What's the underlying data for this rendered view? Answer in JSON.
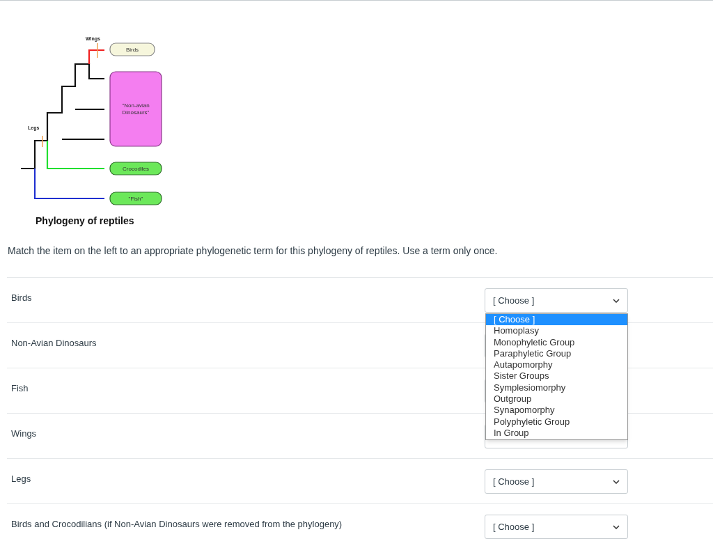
{
  "figure": {
    "traits": [
      {
        "label": "Wings"
      },
      {
        "label": "Legs"
      }
    ],
    "taxa": [
      {
        "label": "Birds",
        "color": "#f6f6dc"
      },
      {
        "label": "\"Non-avian Dinosaurs\"",
        "color": "#f47ef0"
      },
      {
        "label": "Crocodiles",
        "color": "#6ce85a"
      },
      {
        "label": "\"Fish\"",
        "color": "#6ce85a"
      }
    ],
    "caption": "Phylogeny of reptiles"
  },
  "instruction": "Match the item on the left to an appropriate phylogenetic term for this phylogeny of reptiles. Use a term only once.",
  "rows": [
    {
      "label": "Birds",
      "answer": "[ Choose ]"
    },
    {
      "label": "Non-Avian Dinosaurs"
    },
    {
      "label": "Fish"
    },
    {
      "label": "Wings"
    },
    {
      "label": "Legs",
      "answer": "[ Choose ]"
    },
    {
      "label": "Birds and Crocodilians (if Non-Avian Dinosaurs were removed from the phylogeny)",
      "answer": "[ Choose ]"
    }
  ],
  "dropdown": {
    "options": [
      {
        "label": "[ Choose ]",
        "selected": true
      },
      {
        "label": "Homoplasy",
        "selected": false
      },
      {
        "label": "Monophyletic Group",
        "selected": false
      },
      {
        "label": "Paraphyletic Group",
        "selected": false
      },
      {
        "label": "Autapomorphy",
        "selected": false
      },
      {
        "label": "Sister Groups",
        "selected": false
      },
      {
        "label": "Symplesiomorphy",
        "selected": false
      },
      {
        "label": "Outgroup",
        "selected": false
      },
      {
        "label": "Synapomorphy",
        "selected": false
      },
      {
        "label": "Polyphyletic Group",
        "selected": false
      },
      {
        "label": "In Group",
        "selected": false
      }
    ]
  }
}
